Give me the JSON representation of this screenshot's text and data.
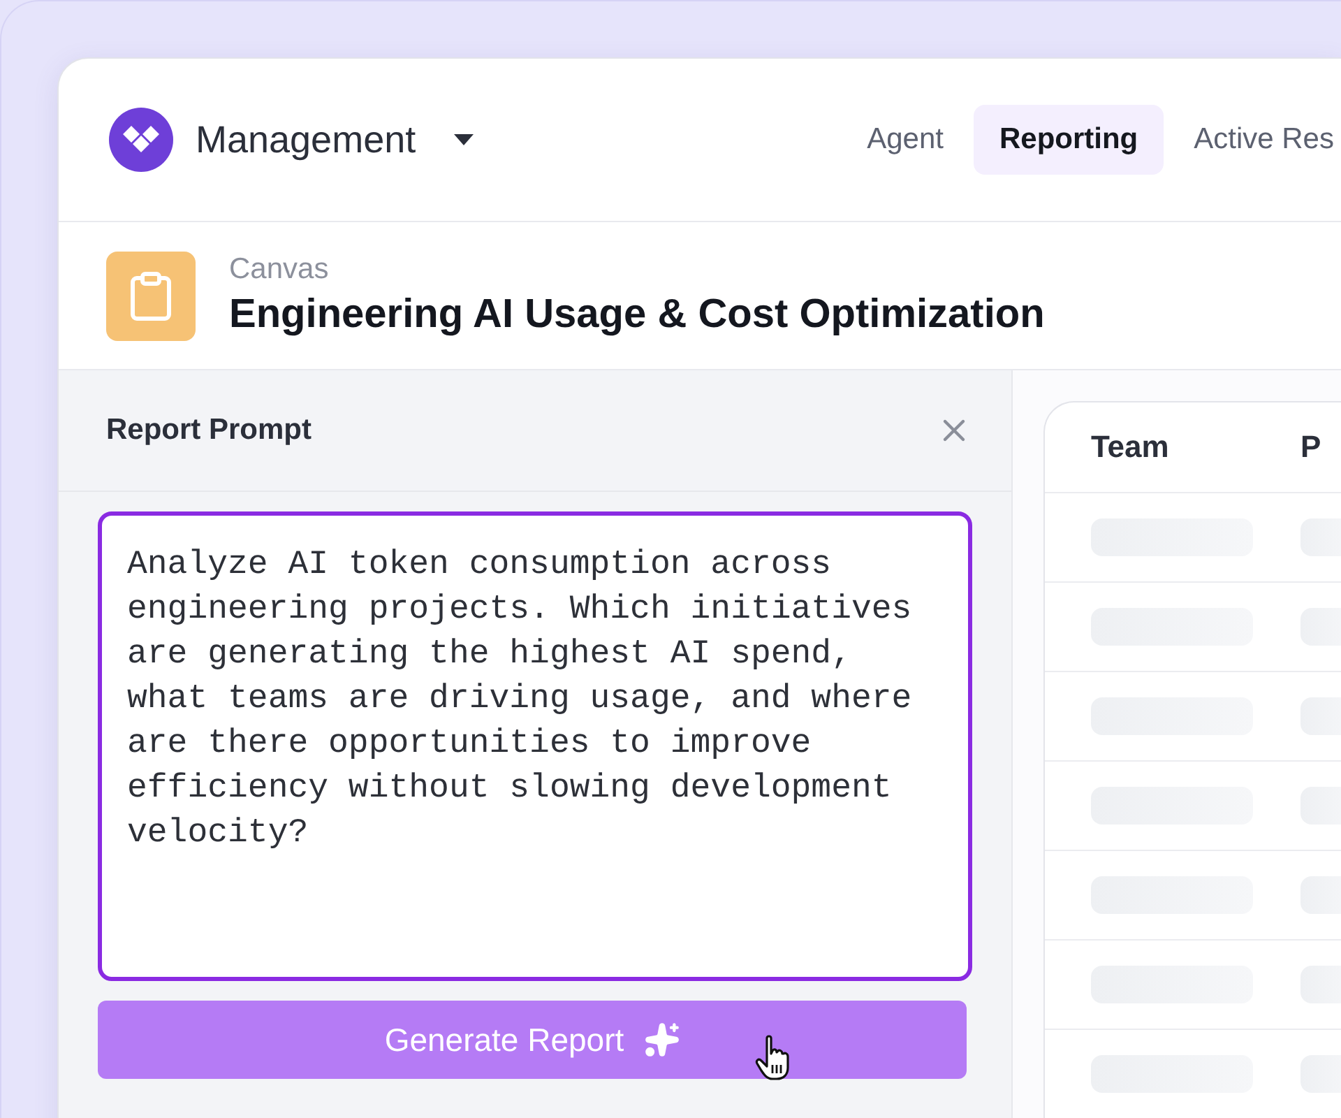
{
  "app": {
    "workspace": "Management"
  },
  "tabs": [
    {
      "label": "Agent",
      "selected": false
    },
    {
      "label": "Reporting",
      "selected": true
    },
    {
      "label": "Active Res",
      "selected": false
    }
  ],
  "canvas": {
    "eyebrow": "Canvas",
    "title": "Engineering AI Usage & Cost Optimization"
  },
  "prompt_panel": {
    "title": "Report Prompt",
    "prompt": "Analyze AI token consumption across engineering projects. Which initiatives are generating the highest AI spend, what teams are driving usage, and where are there opportunities to improve efficiency without slowing development velocity?",
    "button": "Generate Report"
  },
  "table": {
    "columns": [
      "Team",
      "P"
    ]
  }
}
